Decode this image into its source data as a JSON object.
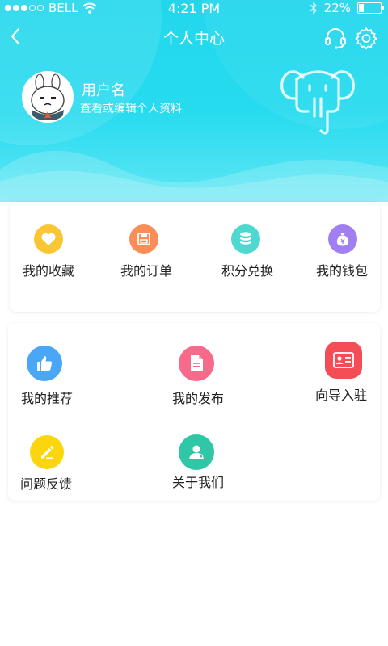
{
  "status_bar": {
    "carrier": "BELL",
    "time": "4:21 PM",
    "battery": "22%"
  },
  "nav": {
    "title": "个人中心",
    "back_icon": "chevron-left-icon",
    "service_icon": "headset-icon",
    "settings_icon": "gear-icon"
  },
  "profile": {
    "username": "用户名",
    "subtitle": "查看或编辑个人资料"
  },
  "quick_actions": [
    {
      "label": "我的收藏",
      "icon": "heart-icon",
      "color": "#fbc634"
    },
    {
      "label": "我的订单",
      "icon": "save-icon",
      "color": "#f98d58"
    },
    {
      "label": "积分兑换",
      "icon": "coins-icon",
      "color": "#4fd8cf"
    },
    {
      "label": "我的钱包",
      "icon": "money-bag-icon",
      "color": "#a27ff0"
    }
  ],
  "services": [
    {
      "label": "我的推荐",
      "icon": "thumbs-up-icon",
      "color": "#4aa7f7"
    },
    {
      "label": "我的发布",
      "icon": "document-icon",
      "color": "#f76a8c"
    },
    {
      "label": "向导入驻",
      "icon": "id-card-icon",
      "color": "#f54d55"
    },
    {
      "label": "问题反馈",
      "icon": "edit-icon",
      "color": "#fbd60d"
    },
    {
      "label": "关于我们",
      "icon": "user-icon",
      "color": "#2fc7a6"
    }
  ],
  "colors": {
    "header": "#22d6ec",
    "background": "#ffffff"
  }
}
